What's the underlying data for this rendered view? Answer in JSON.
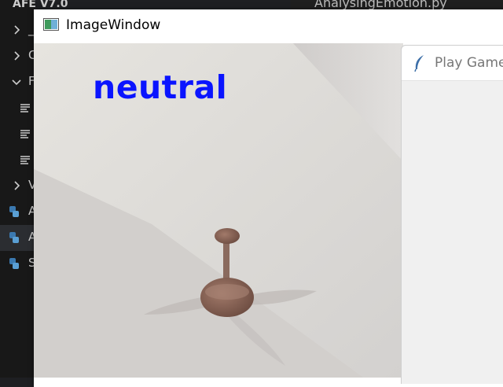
{
  "explorer": {
    "title": "AFE V7.0",
    "rows": [
      {
        "label": "_",
        "kind": "folder-collapsed"
      },
      {
        "label": "C",
        "kind": "folder-collapsed"
      },
      {
        "label": "F",
        "kind": "folder-expanded"
      },
      {
        "label": "",
        "kind": "file"
      },
      {
        "label": "",
        "kind": "file"
      },
      {
        "label": "",
        "kind": "file"
      },
      {
        "label": "V",
        "kind": "folder-collapsed"
      },
      {
        "label": "A",
        "kind": "python"
      },
      {
        "label": "A",
        "kind": "python"
      },
      {
        "label": "S",
        "kind": "python"
      }
    ]
  },
  "editor": {
    "tab_label": "AnalysingEmotion.py"
  },
  "image_window": {
    "title": "ImageWindow",
    "emotion": "neutral",
    "emotion_color": "#0a14ff",
    "icon": "opencv-window-icon",
    "scene": "ceiling-fan-camera-feed"
  },
  "play_window": {
    "title": "Play Game",
    "icon": "tk-feather-icon"
  }
}
